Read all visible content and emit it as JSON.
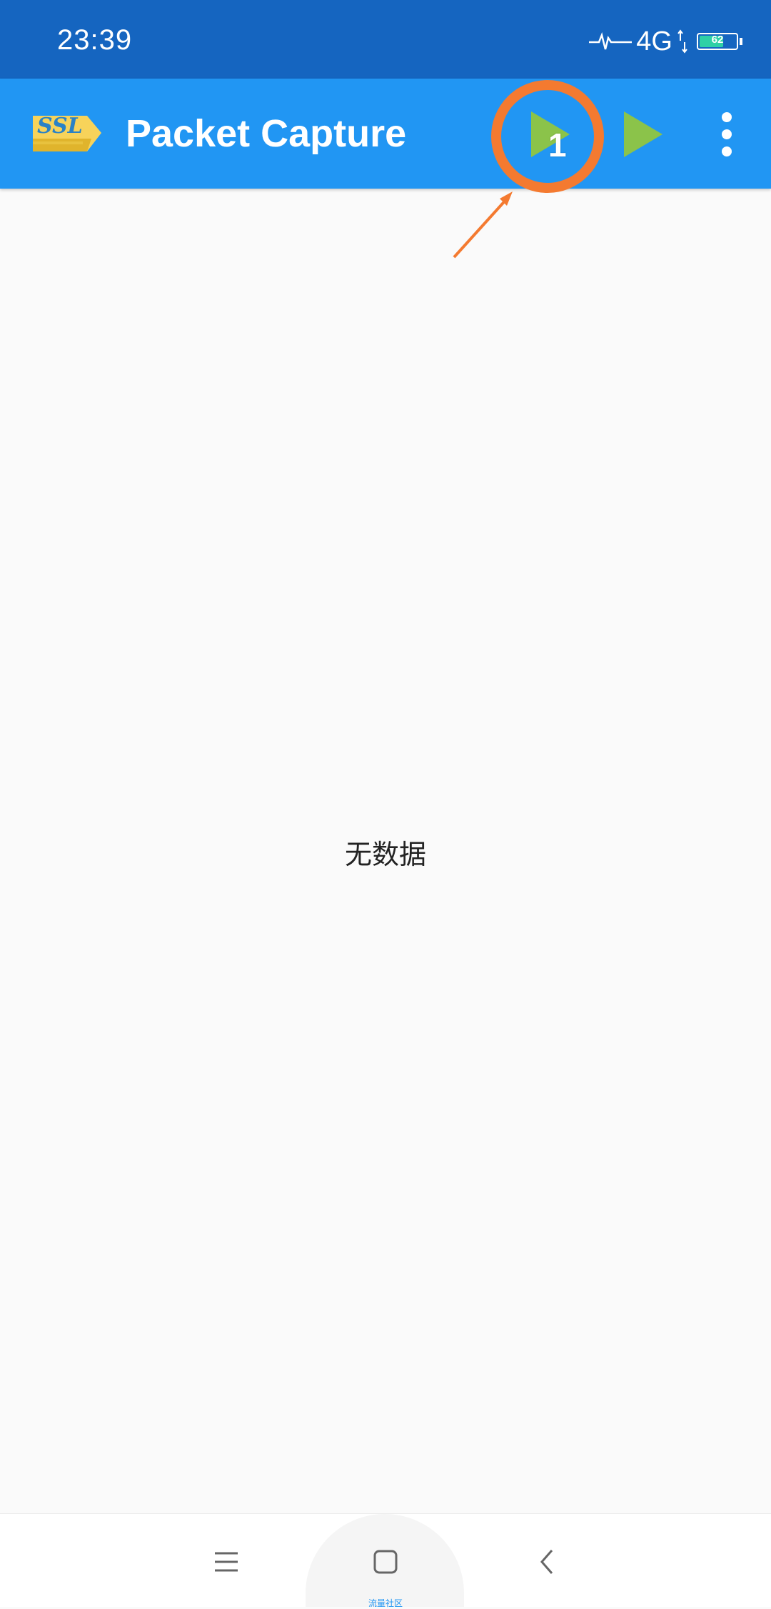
{
  "status_bar": {
    "time": "23:39",
    "network": "4G",
    "battery_level": "62",
    "battery_color": "#2ed0a6"
  },
  "app_bar": {
    "title": "Packet Capture",
    "logo_text": "SSL",
    "actions": [
      {
        "name": "start-capture-app-button",
        "icon": "play-icon"
      },
      {
        "name": "start-capture-button",
        "icon": "play-icon"
      },
      {
        "name": "overflow-menu-button",
        "icon": "more-vert-icon"
      }
    ],
    "bg_color": "#2196f3",
    "status_color": "#1565c0"
  },
  "annotation": {
    "number": "1",
    "color": "#f47a30"
  },
  "main": {
    "empty_text": "无数据"
  },
  "nav_bar": {
    "label": "流量社区",
    "buttons": [
      "menu-icon",
      "home-icon",
      "back-icon"
    ]
  }
}
